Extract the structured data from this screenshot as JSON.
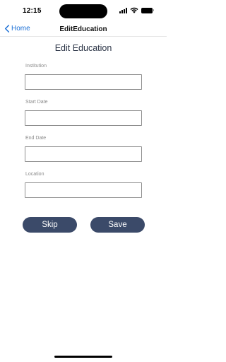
{
  "status_bar": {
    "time": "12:15"
  },
  "nav": {
    "back_label": "Home",
    "title": "EditEducation"
  },
  "page": {
    "title": "Edit Education"
  },
  "form": {
    "fields": [
      {
        "label": "Institution",
        "value": ""
      },
      {
        "label": "Start Date",
        "value": ""
      },
      {
        "label": "End Date",
        "value": ""
      },
      {
        "label": "Location",
        "value": ""
      }
    ]
  },
  "actions": {
    "skip_label": "Skip",
    "save_label": "Save",
    "button_color": "#3b4a69"
  },
  "theme": {
    "link_color": "#1a6fd6"
  }
}
